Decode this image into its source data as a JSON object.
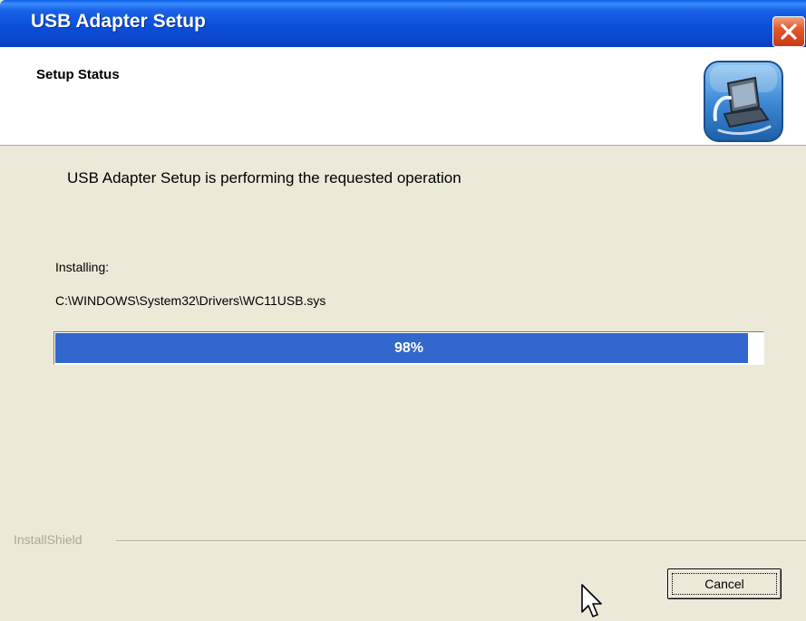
{
  "window": {
    "title": "USB Adapter Setup"
  },
  "header": {
    "title": "Setup Status",
    "icon": "installer-computer-icon"
  },
  "main": {
    "status_message": "USB Adapter Setup is performing the requested operation",
    "installing_label": "Installing:",
    "file_path": "C:\\WINDOWS\\System32\\Drivers\\WC11USB.sys",
    "progress": {
      "percent": 98,
      "label": "98%",
      "fill_color": "#3267cd"
    }
  },
  "footer": {
    "brand": "InstallShield",
    "cancel_label": "Cancel"
  },
  "colors": {
    "titlebar": "#0a4fd8",
    "close_button": "#e2582e",
    "dialog_background": "#ece9d8"
  }
}
